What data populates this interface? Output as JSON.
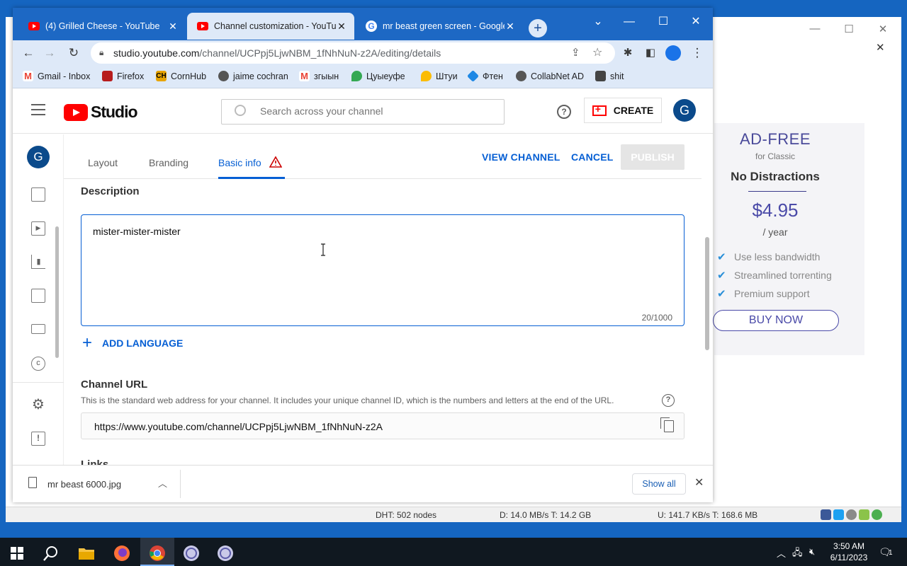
{
  "background_app": {
    "ad": {
      "title": "AD-FREE",
      "subtitle": "for Classic",
      "headline": "No Distractions",
      "price": "$4.95",
      "period": "/ year",
      "features": [
        "Use less bandwidth",
        "Streamlined torrenting",
        "Premium support"
      ],
      "buy_label": "BUY NOW"
    },
    "status": {
      "dht": "DHT: 502 nodes",
      "download": "D: 14.0 MB/s T: 14.2 GB",
      "upload": "U: 141.7 KB/s T: 168.6 MB"
    }
  },
  "browser": {
    "tabs": [
      {
        "title": "(4) Grilled Cheese - YouTube",
        "icon": "youtube-icon"
      },
      {
        "title": "Channel customization - YouTube Studio",
        "icon": "youtube-icon"
      },
      {
        "title": "mr beast green screen - Google Search",
        "icon": "google-icon"
      }
    ],
    "url_host": "studio.youtube.com",
    "url_path": "/channel/UCPpj5LjwNBM_1fNhNuN-z2A/editing/details",
    "bookmarks": [
      {
        "label": "Gmail - Inbox",
        "icon": "gmail-icon",
        "color": "#ea4335"
      },
      {
        "label": "Firefox",
        "icon": "firefox-icon",
        "color": "#b71c1c"
      },
      {
        "label": "CornHub",
        "icon": "ch-icon",
        "color": "#e8a400"
      },
      {
        "label": "jaime cochran",
        "icon": "globe-icon",
        "color": "#555555"
      },
      {
        "label": "згыын",
        "icon": "gmail-icon",
        "color": "#ea4335"
      },
      {
        "label": "Цуыеуфе",
        "icon": "maps-pin-icon",
        "color": "#34a853"
      },
      {
        "label": "Штуи",
        "icon": "maps-pin-icon",
        "color": "#fbbc04"
      },
      {
        "label": "Фтен",
        "icon": "diamond-icon",
        "color": "#1e88e5"
      },
      {
        "label": "CollabNet AD",
        "icon": "globe-icon",
        "color": "#555555"
      },
      {
        "label": "shit",
        "icon": "image-icon",
        "color": "#444444"
      }
    ],
    "downloads": {
      "file": "mr beast 6000.jpg",
      "show_all": "Show all"
    }
  },
  "studio": {
    "logo_text": "Studio",
    "search_placeholder": "Search across your channel",
    "create_label": "CREATE",
    "avatar_letter": "G",
    "tabs": [
      "Layout",
      "Branding",
      "Basic info"
    ],
    "actions": {
      "view_channel": "VIEW CHANNEL",
      "cancel": "CANCEL",
      "publish": "PUBLISH"
    },
    "description": {
      "label": "Description",
      "value": "mister-mister-mister",
      "count": "20/1000"
    },
    "add_language": "ADD LANGUAGE",
    "channel_url": {
      "label": "Channel URL",
      "help": "This is the standard web address for your channel. It includes your unique channel ID, which is the numbers and letters at the end of the URL.",
      "value": "https://www.youtube.com/channel/UCPpj5LjwNBM_1fNhNuN-z2A"
    },
    "links_label": "Links"
  },
  "taskbar": {
    "time": "3:50 AM",
    "date": "6/11/2023",
    "notifications": "1"
  },
  "colors": {
    "youtube_red": "#ff0000",
    "link_blue": "#065fd4",
    "chrome_frame": "#1d68c4",
    "desktop": "#1565c0"
  }
}
